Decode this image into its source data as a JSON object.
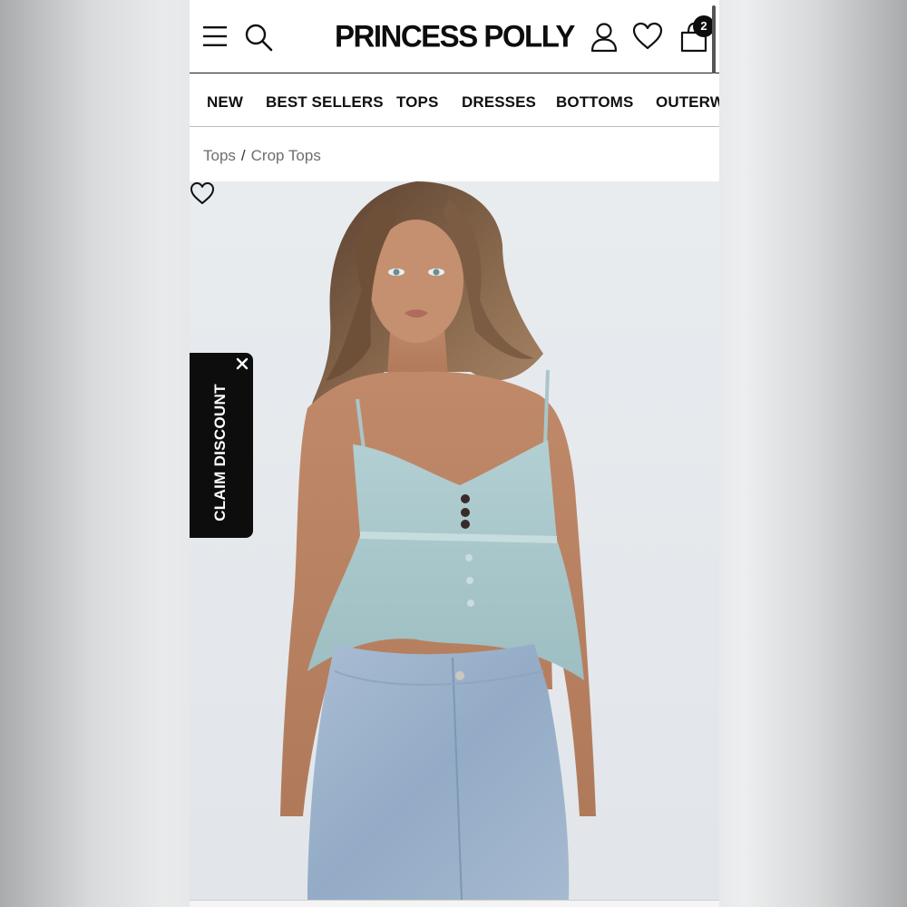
{
  "header": {
    "logo": "PRINCESS POLLY",
    "cart_count": "2",
    "icons": [
      "menu-icon",
      "search-icon",
      "account-icon",
      "heart-icon",
      "bag-icon"
    ]
  },
  "nav": {
    "items": [
      {
        "label": "NEW"
      },
      {
        "label": "BEST SELLERS"
      },
      {
        "label": "TOPS"
      },
      {
        "label": "DRESSES"
      },
      {
        "label": "BOTTOMS"
      },
      {
        "label": "OUTERW"
      }
    ]
  },
  "breadcrumb": {
    "items": [
      "Tops",
      "Crop Tops"
    ],
    "separator": "/"
  },
  "promo": {
    "label": "CLAIM DISCOUNT",
    "close_icon": "close-icon"
  },
  "product": {
    "wishlist_icon": "heart-icon"
  },
  "colors": {
    "brand": "#0d0d0d",
    "top": "#a9c8cb",
    "denim": "#9db4cc"
  }
}
